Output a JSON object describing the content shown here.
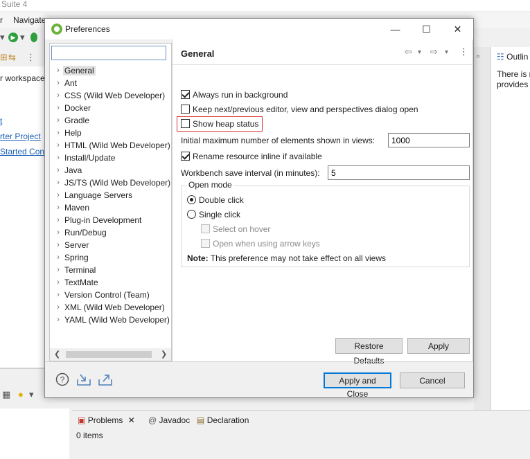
{
  "ide": {
    "title": "Suite 4",
    "menus": [
      "r",
      "Navigate"
    ],
    "left_panel": {
      "text1": "r workspace",
      "link1": "t",
      "link2": "rter Project",
      "link3": "Started Con"
    },
    "right_panel": {
      "tab": "Outlin",
      "line1": "There is n",
      "line2": "provides"
    },
    "bottom_tabs": [
      "Problems",
      "Javadoc",
      "Declaration"
    ],
    "status": "0 items"
  },
  "dialog": {
    "title": "Preferences",
    "window_controls": {
      "minimize": "—",
      "maximize": "☐",
      "close": "✕"
    },
    "filter_value": "",
    "tree_items": [
      "General",
      "Ant",
      "CSS (Wild Web Developer)",
      "Docker",
      "Gradle",
      "Help",
      "HTML (Wild Web Developer)",
      "Install/Update",
      "Java",
      "JS/TS (Wild Web Developer)",
      "Language Servers",
      "Maven",
      "Plug-in Development",
      "Run/Debug",
      "Server",
      "Spring",
      "Terminal",
      "TextMate",
      "Version Control (Team)",
      "XML (Wild Web Developer)",
      "YAML (Wild Web Developer)"
    ],
    "selected_item": "General",
    "page": {
      "title": "General",
      "always_run_bg": "Always run in background",
      "keep_next_prev": "Keep next/previous editor, view and perspectives dialog open",
      "show_heap": "Show heap status",
      "initial_max_label": "Initial maximum number of elements shown in views:",
      "initial_max_value": "1000",
      "rename_inline": "Rename resource inline if available",
      "save_interval_label": "Workbench save interval (in minutes):",
      "save_interval_value": "5",
      "open_mode": {
        "legend": "Open mode",
        "double_click": "Double click",
        "single_click": "Single click",
        "select_on_hover": "Select on hover",
        "open_arrow_keys": "Open when using arrow keys"
      },
      "note_bold": "Note:",
      "note_text": " This preference may not take effect on all views"
    },
    "buttons": {
      "restore_defaults": "Restore Defaults",
      "apply": "Apply",
      "apply_and_close": "Apply and Close",
      "cancel": "Cancel"
    },
    "accent_color": "#0078d7",
    "highlight_color": "#d93030"
  }
}
